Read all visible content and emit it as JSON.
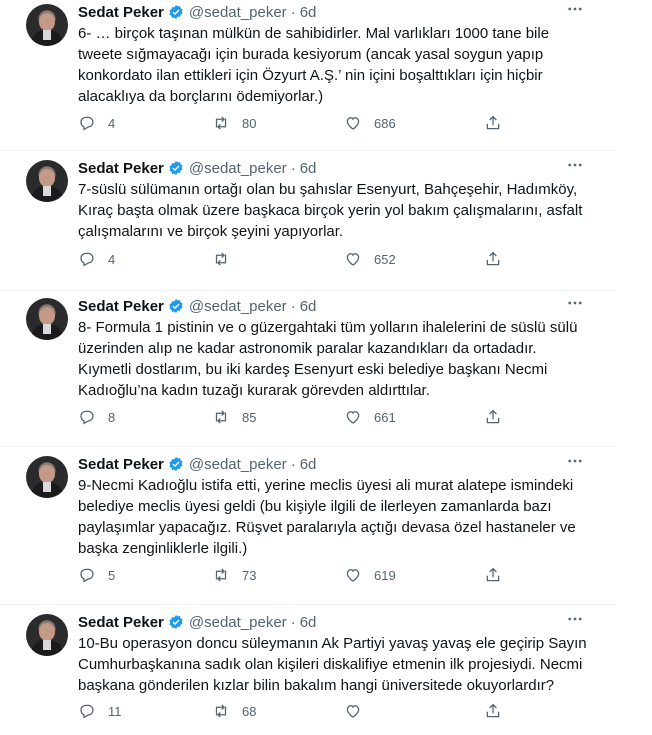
{
  "tweets": [
    {
      "name": "Sedat Peker",
      "handle": "@sedat_peker",
      "time": "6d",
      "text": "6- … birçok taşınan mülkün de sahibidirler. Mal varlıkları 1000 tane bile\ntweete sığmayacağı için burada kesiyorum (ancak yasal soygun yapıp\nkonkordato ilan ettikleri için Özyurt A.Ş.’ nin içini boşalttıkları için hiçbir\nalacaklıya da borçlarını ödemiyorlar.)",
      "replies": "4",
      "retweets": "80",
      "likes": "686"
    },
    {
      "name": "Sedat Peker",
      "handle": "@sedat_peker",
      "time": "6d",
      "text": "7-süslü sülümanın ortağı olan bu şahıslar Esenyurt, Bahçeşehir, Hadımköy,\nKıraç başta olmak üzere başkaca birçok yerin yol bakım çalışmalarını, asfalt\nçalışmalarını ve birçok şeyini yapıyorlar.",
      "replies": "4",
      "retweets": "",
      "likes": "652"
    },
    {
      "name": "Sedat Peker",
      "handle": "@sedat_peker",
      "time": "6d",
      "text": "8- Formula 1 pistinin ve o güzergahtaki tüm yolların ihalelerini de süslü sülü\nüzerinden alıp ne kadar astronomik paralar kazandıkları da ortadadır.\nKıymetli dostlarım, bu iki kardeş Esenyurt eski belediye başkanı Necmi\nKadıoğlu’na kadın tuzağı kurarak görevden aldırttılar.",
      "replies": "8",
      "retweets": "85",
      "likes": "661"
    },
    {
      "name": "Sedat Peker",
      "handle": "@sedat_peker",
      "time": "6d",
      "text": "9-Necmi Kadıoğlu istifa etti, yerine meclis üyesi ali murat alatepe ismindeki\nbelediye meclis üyesi geldi (bu kişiyle ilgili de ilerleyen zamanlarda bazı\npaylaşımlar yapacağız. Rüşvet paralarıyla açtığı devasa özel hastaneler ve\nbaşka zenginliklerle ilgili.)",
      "replies": "5",
      "retweets": "73",
      "likes": "619"
    },
    {
      "name": "Sedat Peker",
      "handle": "@sedat_peker",
      "time": "6d",
      "text": "10-Bu operasyon doncu süleymanın Ak Partiyi yavaş yavaş ele geçirip Sayın\nCumhurbaşkanına sadık olan kişileri diskalifiye etmenin ilk projesiydi. Necmi\nbaşkana gönderilen kızlar bilin bakalım hangi üniversitede okuyorlardır?",
      "replies": "11",
      "retweets": "68",
      "likes": ""
    }
  ],
  "icons": {
    "reply": "reply-icon",
    "retweet": "retweet-icon",
    "like": "heart-icon",
    "share": "share-icon",
    "more": "more-icon",
    "verified": "verified-badge-icon"
  },
  "colors": {
    "text": "#0f1419",
    "secondary": "#536471",
    "verified": "#1d9bf0",
    "divider": "#eff3f4"
  }
}
